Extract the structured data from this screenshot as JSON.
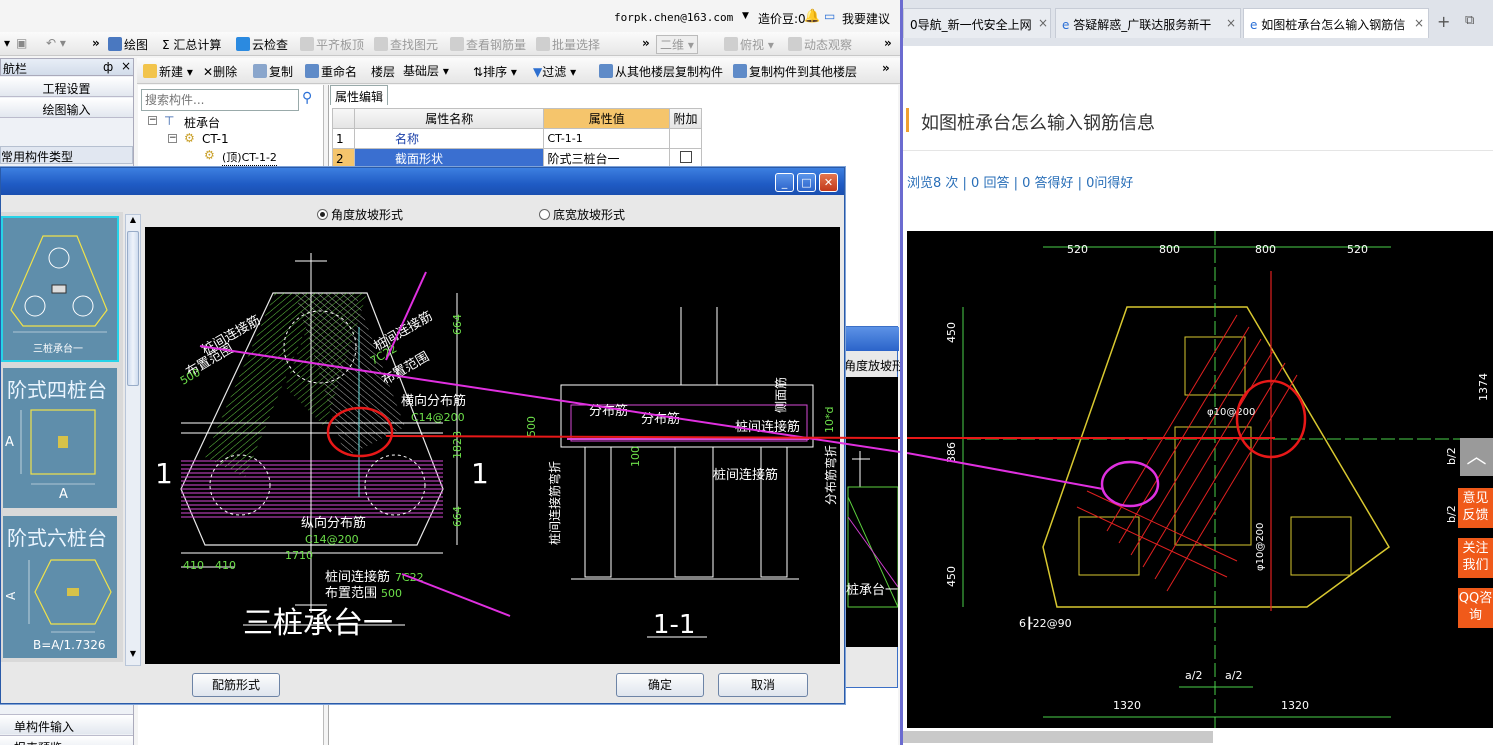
{
  "top_bar": {
    "email": "forpk.chen@163.com",
    "beans": "造价豆:0",
    "suggest": "我要建议"
  },
  "toolbar1": {
    "draw": "绘图",
    "sum": "Σ 汇总计算",
    "cloud": "云检查",
    "flat": "平齐板顶",
    "find": "查找图元",
    "view_rebar": "查看钢筋量",
    "batch": "批量选择",
    "dim": "二维",
    "perspective": "俯视",
    "dynamic": "动态观察"
  },
  "nav": {
    "header": "航栏",
    "pin": "ф",
    "close": "×",
    "project_settings": "工程设置",
    "draw_input": "绘图输入",
    "common_types": "常用构件类型",
    "single_input": "单构件输入",
    "report": "报表预览"
  },
  "toolbar2": {
    "new": "新建",
    "delete": "删除",
    "copy": "复制",
    "rename": "重命名",
    "floor": "楼层",
    "floor_value": "基础层",
    "sort": "排序",
    "filter": "过滤",
    "copy_from": "从其他楼层复制构件",
    "copy_to": "复制构件到其他楼层"
  },
  "search": {
    "placeholder": "搜索构件..."
  },
  "tree": {
    "root": "桩承台",
    "child": "CT-1",
    "leaf": "(顶)CT-1-2"
  },
  "props": {
    "tab": "属性编辑",
    "col_name": "属性名称",
    "col_value": "属性值",
    "col_extra": "附加",
    "rows": [
      {
        "no": "1",
        "name": "名称",
        "value": "CT-1-1"
      },
      {
        "no": "2",
        "name": "截面形状",
        "value": "阶式三桩台一"
      }
    ]
  },
  "dialog": {
    "radio_angle": "角度放坡形式",
    "radio_width": "底宽放坡形式",
    "thumbs": [
      {
        "title": "",
        "caption": "三桩承台一"
      },
      {
        "title": "阶式四桩台",
        "caption": ""
      },
      {
        "title": "阶式六桩台",
        "caption": "B=A/1.7326"
      }
    ],
    "btn_rebar": "配筋形式",
    "btn_ok": "确定",
    "btn_cancel": "取消"
  },
  "cad": {
    "title_main": "三桩承台一",
    "title_section": "1-1",
    "label_pile_link": "桩间连接筋",
    "label_range": "布置范围",
    "label_horiz": "横向分布筋",
    "label_vert": "纵向分布筋",
    "label_dist": "分布筋",
    "label_side": "侧面筋",
    "label_dist_bend": "分布筋弯折",
    "label_link_bend": "桩间连接筋弯折",
    "r1": "7C22",
    "r2": "C14@200",
    "r3": "500",
    "d1": "1710",
    "d2": "410",
    "d3": "664",
    "d4": "1828",
    "d5": "10*d",
    "d6": "100",
    "sec": "1",
    "section_mark": "1"
  },
  "browser": {
    "tabs": [
      "0导航_新一代安全上网",
      "答疑解惑_广联达服务新干",
      "如图桩承台怎么输入钢筋信"
    ],
    "question": "如图桩承台怎么输入钢筋信息",
    "stats": "浏览8 次 | 0 回答 | 0 答得好 | 0问得好",
    "side": [
      "意见反馈",
      "关注我们",
      "QQ咨询"
    ]
  },
  "photo": {
    "dims_top": [
      "520",
      "800",
      "800",
      "520"
    ],
    "dims_left": [
      "450",
      "386",
      "450"
    ],
    "dims_bottom": [
      "1320",
      "1320"
    ],
    "dims_mid": [
      "a/2",
      "a/2"
    ],
    "note1": "6┠22@90",
    "note2": "φ10@200",
    "note3": "1374",
    "note4": "b/2"
  }
}
